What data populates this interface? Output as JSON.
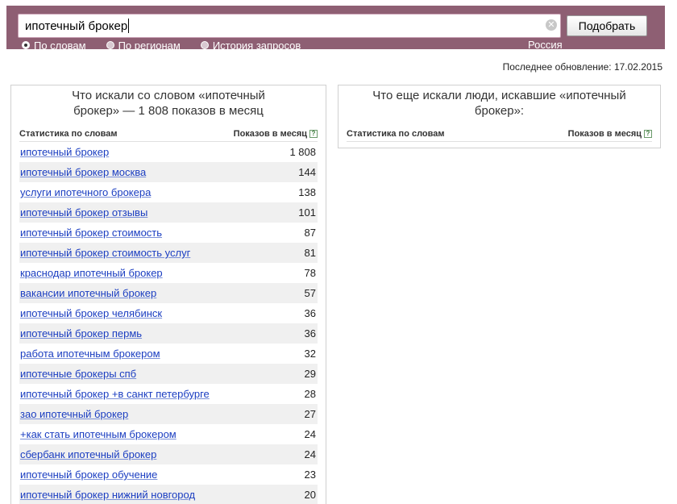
{
  "search": {
    "query": "ипотечный брокер",
    "submit_label": "Подобрать"
  },
  "modes": [
    {
      "label": "По словам",
      "checked": true
    },
    {
      "label": "По регионам",
      "checked": false
    },
    {
      "label": "История запросов",
      "checked": false
    }
  ],
  "region": "Россия",
  "updated": "Последнее обновление: 17.02.2015",
  "left_panel": {
    "title": "Что искали со словом «ипотечный брокер» — 1 808 показов в месяц",
    "col_words": "Статистика по словам",
    "col_shows": "Показов в месяц",
    "rows": [
      {
        "keyword": "ипотечный брокер",
        "count": "1 808"
      },
      {
        "keyword": "ипотечный брокер москва",
        "count": "144"
      },
      {
        "keyword": "услуги ипотечного брокера",
        "count": "138"
      },
      {
        "keyword": "ипотечный брокер отзывы",
        "count": "101"
      },
      {
        "keyword": "ипотечный брокер стоимость",
        "count": "87"
      },
      {
        "keyword": "ипотечный брокер стоимость услуг",
        "count": "81"
      },
      {
        "keyword": "краснодар ипотечный брокер",
        "count": "78"
      },
      {
        "keyword": "вакансии ипотечный брокер",
        "count": "57"
      },
      {
        "keyword": "ипотечный брокер челябинск",
        "count": "36"
      },
      {
        "keyword": "ипотечный брокер пермь",
        "count": "36"
      },
      {
        "keyword": "работа ипотечным брокером",
        "count": "32"
      },
      {
        "keyword": "ипотечные брокеры спб",
        "count": "29"
      },
      {
        "keyword": "ипотечный брокер +в санкт петербурге",
        "count": "28"
      },
      {
        "keyword": "зао ипотечный брокер",
        "count": "27"
      },
      {
        "keyword": "+как стать ипотечным брокером",
        "count": "24"
      },
      {
        "keyword": "сбербанк ипотечный брокер",
        "count": "24"
      },
      {
        "keyword": "ипотечный брокер обучение",
        "count": "23"
      },
      {
        "keyword": "ипотечный брокер нижний новгород",
        "count": "20"
      }
    ]
  },
  "right_panel": {
    "title": "Что еще искали люди, искавшие «ипотечный брокер»:",
    "col_words": "Статистика по словам",
    "col_shows": "Показов в месяц"
  },
  "colors": {
    "header_bg": "#8e5f73",
    "link": "#1a3dc1",
    "row_alt": "#f0f0f0"
  }
}
